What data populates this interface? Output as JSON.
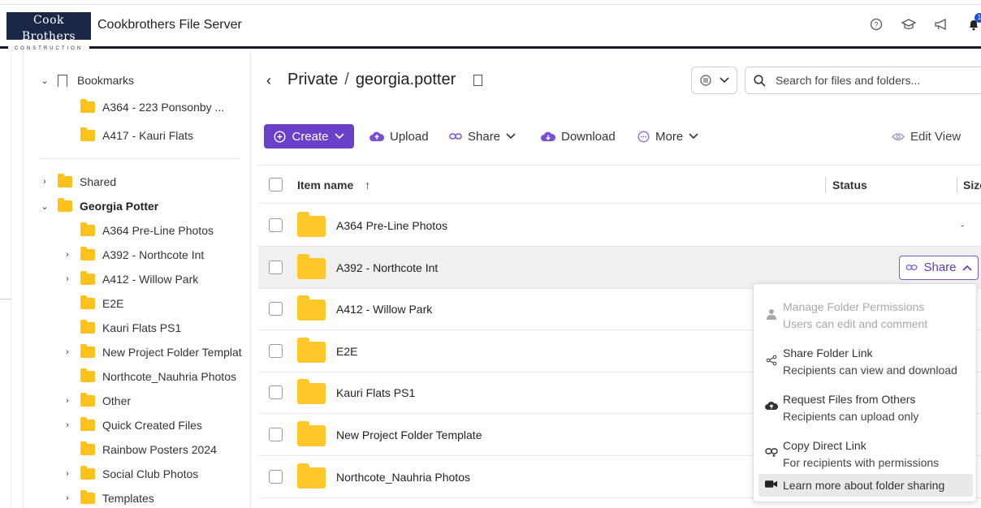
{
  "header": {
    "logo_line1": "Cook Brothers",
    "logo_line2": "CONSTRUCTION",
    "title": "Cookbrothers File Server",
    "icons": [
      "help-icon",
      "graduation-cap-icon",
      "megaphone-icon",
      "bell-icon"
    ],
    "notification_count": "1"
  },
  "sidebar": {
    "bookmarks_label": "Bookmarks",
    "bookmarks": [
      "A364 - 223 Ponsonby ...",
      "A417 - Kauri Flats"
    ],
    "shared_label": "Shared",
    "user_label": "Georgia Potter",
    "folders": [
      {
        "label": "A364 Pre-Line Photos",
        "expandable": false
      },
      {
        "label": "A392 - Northcote Int",
        "expandable": true
      },
      {
        "label": "A412 - Willow Park",
        "expandable": true
      },
      {
        "label": "E2E",
        "expandable": false
      },
      {
        "label": "Kauri Flats PS1",
        "expandable": false
      },
      {
        "label": "New Project Folder Templat",
        "expandable": true
      },
      {
        "label": "Northcote_Nauhria Photos",
        "expandable": false
      },
      {
        "label": "Other",
        "expandable": true
      },
      {
        "label": "Quick Created Files",
        "expandable": true
      },
      {
        "label": "Rainbow Posters 2024",
        "expandable": false
      },
      {
        "label": "Social Club Photos",
        "expandable": true
      },
      {
        "label": "Templates",
        "expandable": true
      }
    ]
  },
  "breadcrumb": {
    "root": "Private",
    "separator": "/",
    "current": "georgia.potter"
  },
  "search": {
    "placeholder": "Search for files and folders..."
  },
  "toolbar": {
    "create": "Create",
    "upload": "Upload",
    "share": "Share",
    "download": "Download",
    "more": "More",
    "edit_view": "Edit View"
  },
  "table": {
    "columns": {
      "name": "Item name",
      "status": "Status",
      "size": "Size"
    },
    "rows": [
      {
        "name": "A364 Pre-Line Photos",
        "size": "-"
      },
      {
        "name": "A392 - Northcote Int",
        "size": ""
      },
      {
        "name": "A412 - Willow Park",
        "size": ""
      },
      {
        "name": "E2E",
        "size": ""
      },
      {
        "name": "Kauri Flats PS1",
        "size": ""
      },
      {
        "name": "New Project Folder Template",
        "size": ""
      },
      {
        "name": "Northcote_Nauhria Photos",
        "size": ""
      }
    ],
    "row_share_label": "Share"
  },
  "share_menu": {
    "items": [
      {
        "title": "Manage Folder Permissions",
        "subtitle": "Users can edit and comment",
        "icon": "user-icon",
        "disabled": true
      },
      {
        "title": "Share Folder Link",
        "subtitle": "Recipients can view and download",
        "icon": "share-nodes-icon",
        "disabled": false
      },
      {
        "title": "Request Files from Others",
        "subtitle": "Recipients can upload only",
        "icon": "cloud-upload-icon",
        "disabled": false
      },
      {
        "title": "Copy Direct Link",
        "subtitle": "For recipients with permissions",
        "icon": "link-icon",
        "disabled": false
      }
    ],
    "learn_more": "Learn more about folder sharing"
  },
  "colors": {
    "accent": "#6a3fc9",
    "folder": "#ffc21a",
    "header_border": "#161a2e"
  }
}
